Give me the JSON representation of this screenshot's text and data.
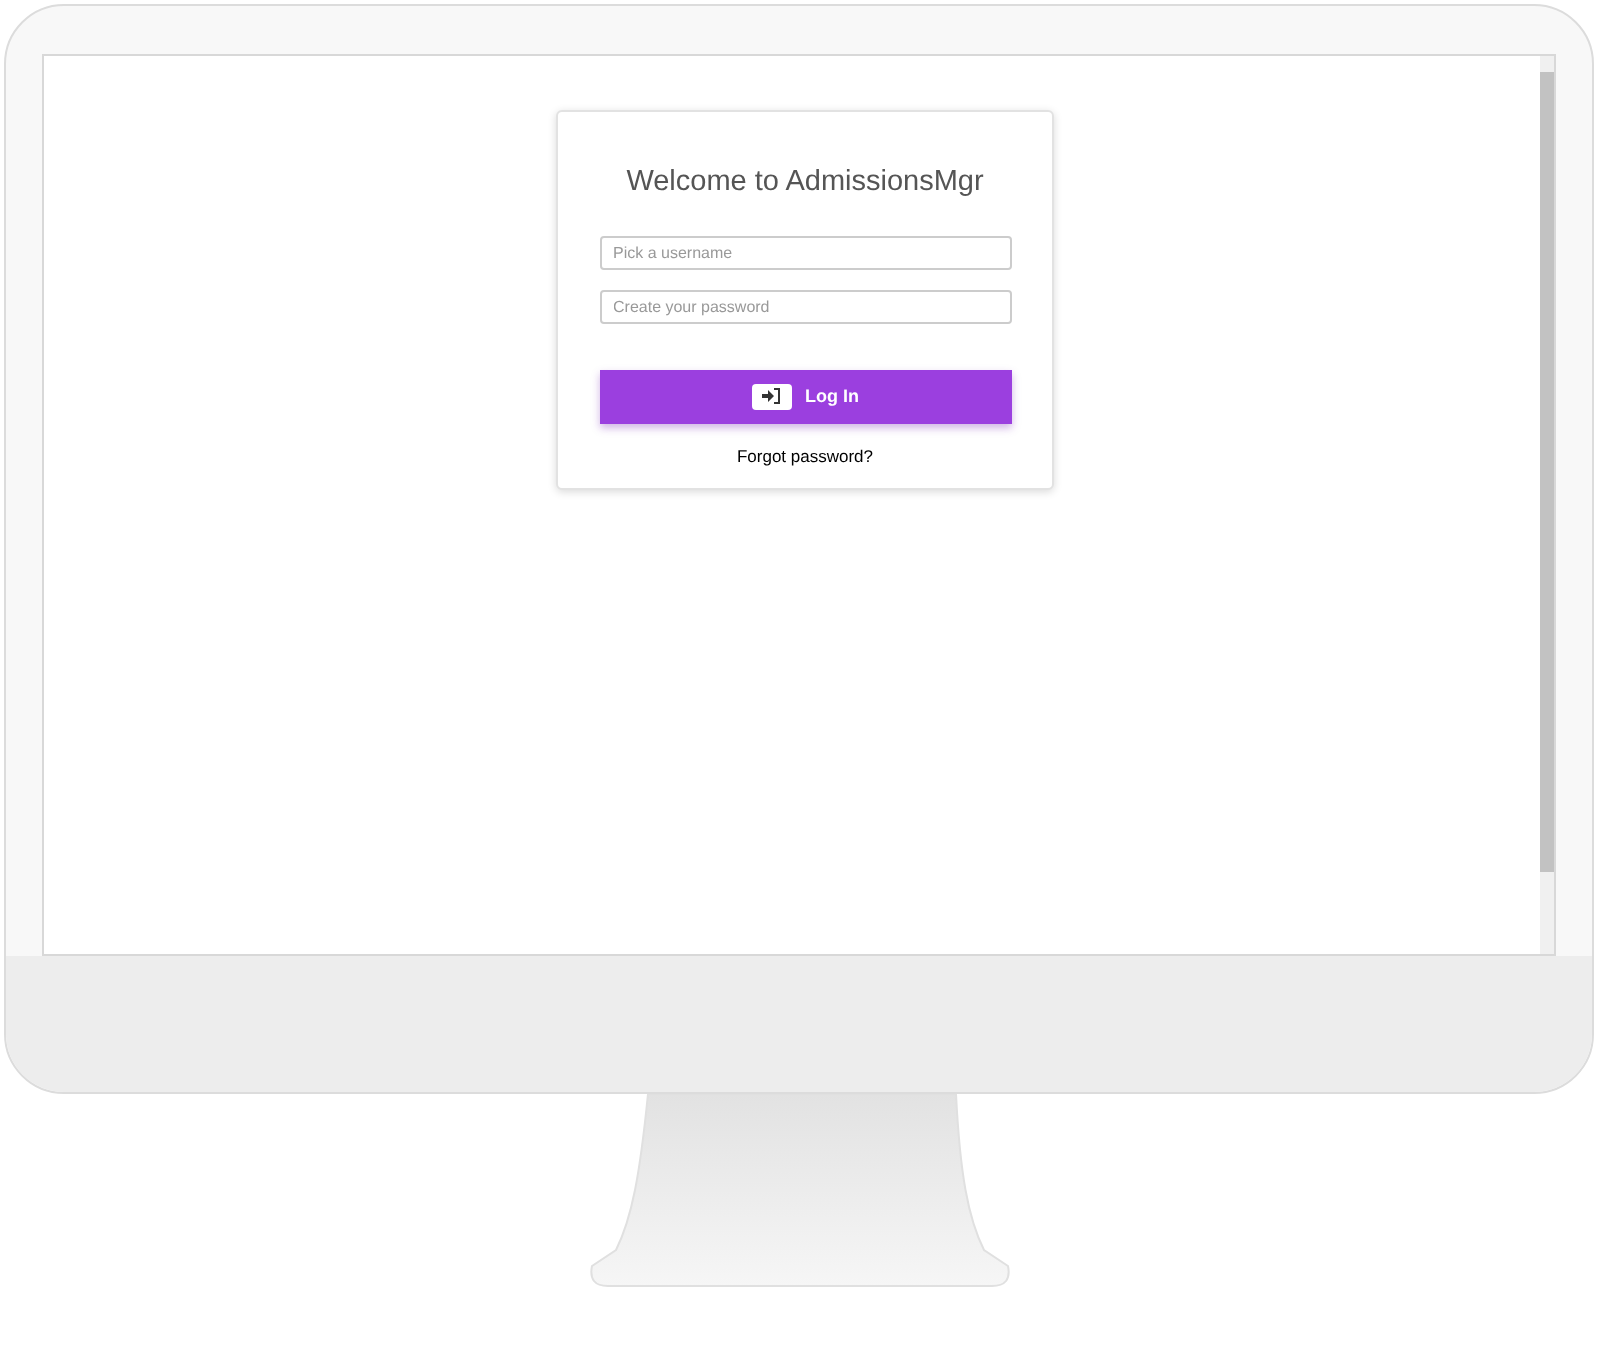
{
  "login_card": {
    "title": "Welcome to AdmissionsMgr",
    "fields": [
      {
        "placeholder": "Pick a username"
      },
      {
        "placeholder": "Create your password"
      }
    ],
    "login_button": {
      "label": "Log In"
    },
    "forgot_link": "Forgot password?"
  }
}
